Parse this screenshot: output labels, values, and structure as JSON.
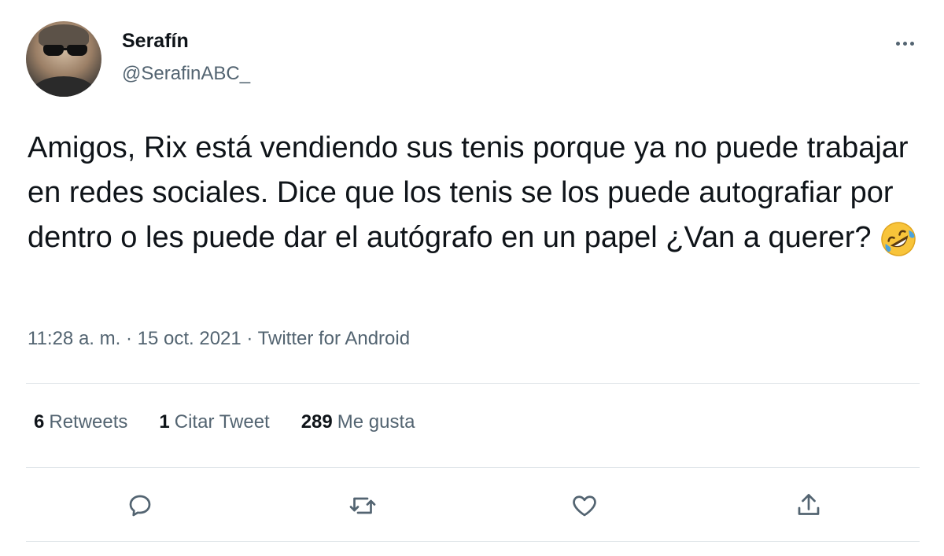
{
  "author": {
    "display_name": "Serafín",
    "handle": "@SerafinABC_"
  },
  "tweet": {
    "text": "Amigos, Rix está vendiendo sus tenis porque ya no puede trabajar en redes sociales. Dice que los tenis se los puede autografiar por dentro o les puede dar el autógrafo en un papel ¿Van a querer?",
    "emoji_icon": "rolling-on-floor-laughing-icon"
  },
  "meta": {
    "time": "11:28 a. m.",
    "date": "15 oct. 2021",
    "source": "Twitter for Android",
    "separator": "·"
  },
  "stats": {
    "retweets_count": "6",
    "retweets_label": "Retweets",
    "quotes_count": "1",
    "quotes_label": "Citar Tweet",
    "likes_count": "289",
    "likes_label": "Me gusta"
  },
  "actions": {
    "reply_icon": "reply-icon",
    "retweet_icon": "retweet-icon",
    "like_icon": "heart-icon",
    "share_icon": "share-icon"
  },
  "colors": {
    "text_primary": "#0f1419",
    "text_secondary": "#536471",
    "divider": "#e1e6ea",
    "emoji_face": "#f8c43a",
    "emoji_tears": "#4aa3df"
  }
}
